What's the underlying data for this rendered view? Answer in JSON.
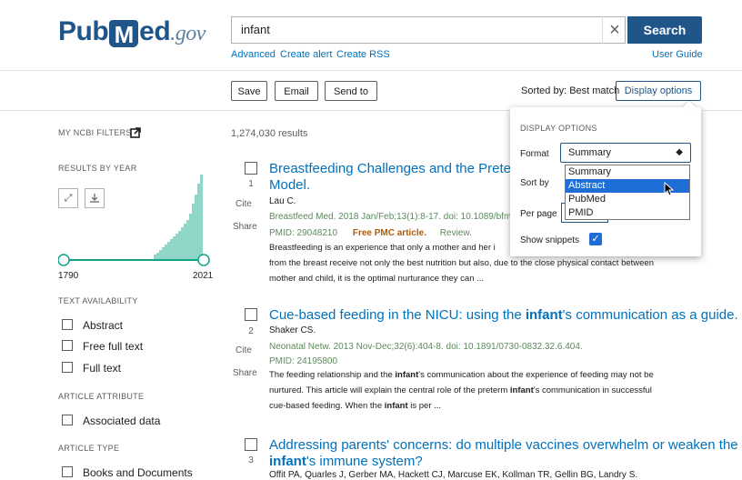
{
  "header": {
    "logo": {
      "part1": "Pub",
      "mark": "M",
      "part2": "ed",
      "gov": ".gov"
    },
    "search": {
      "value": "infant",
      "button": "Search"
    },
    "links": {
      "advanced": "Advanced",
      "create_alert": "Create alert",
      "create_rss": "Create RSS",
      "user_guide": "User Guide"
    }
  },
  "toolbar": {
    "save": "Save",
    "email": "Email",
    "send_to": "Send to",
    "sorted_by": "Sorted by: Best match",
    "display_options": "Display options"
  },
  "sidebar": {
    "filters_heading": "MY NCBI FILTERS",
    "results_by_year": "RESULTS BY YEAR",
    "year_start": "1790",
    "year_end": "2021",
    "text_availability": "TEXT AVAILABILITY",
    "text_options": [
      "Abstract",
      "Free full text",
      "Full text"
    ],
    "article_attribute": "ARTICLE ATTRIBUTE",
    "attribute_options": [
      "Associated data"
    ],
    "article_type": "ARTICLE TYPE",
    "type_options": [
      "Books and Documents"
    ]
  },
  "results": {
    "count": "1,274,030 results",
    "cite_label": "Cite",
    "share_label": "Share",
    "items": [
      {
        "num": "1",
        "title_l1": "Breastfeeding Challenges and the Preterm Mo",
        "title_l2": "Model.",
        "authors": "Lau C.",
        "journal": "Breastfeed Med. 2018 Jan/Feb;13(1):8-17. doi: 10.1089/bfm.",
        "pmid": "PMID: 29048210",
        "free": "Free PMC article.",
        "review": "Review.",
        "snip1": "Breastfeeding is an experience that only a mother and her i",
        "snip2": "from the breast receive not only the best nutrition but also, due to the close physical contact between",
        "snip3": "mother and child, it is the optimal nurturance they can ..."
      },
      {
        "num": "2",
        "title_a": "Cue-based feeding in the NICU: using the ",
        "title_b": "infant",
        "title_c": "'s communication as a guide.",
        "authors": "Shaker CS.",
        "journal": "Neonatal Netw. 2013 Nov-Dec;32(6):404-8. doi: 10.1891/0730-0832.32.6.404.",
        "pmid": "PMID: 24195800",
        "s1a": "The feeding relationship and the ",
        "s1b": "infant",
        "s1c": "'s communication about the experience of feeding may not be",
        "s2a": "nurtured. This article will explain the central role of the preterm ",
        "s2b": "infant",
        "s2c": "'s communication in successful",
        "s3a": "cue-based feeding. When the ",
        "s3b": "infant",
        "s3c": " is per ..."
      },
      {
        "num": "3",
        "title_l1": "Addressing parents' concerns: do multiple vaccines overwhelm or weaken the",
        "title_l2a": "infant",
        "title_l2b": "'s immune system?",
        "authors": "Offit PA, Quarles J, Gerber MA, Hackett CJ, Marcuse EK, Kollman TR, Gellin BG, Landry S."
      }
    ]
  },
  "display_options": {
    "heading": "DISPLAY OPTIONS",
    "format_label": "Format",
    "format_value": "Summary",
    "sort_label": "Sort by",
    "per_page_label": "Per page",
    "snippets_label": "Show snippets",
    "options": [
      "Summary",
      "Abstract",
      "PubMed",
      "PMID"
    ]
  }
}
